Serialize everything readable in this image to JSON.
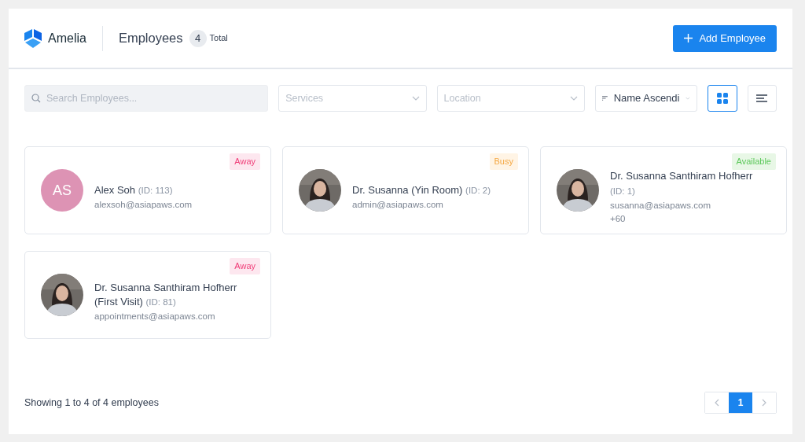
{
  "header": {
    "logo_text": "Amelia",
    "title": "Employees",
    "count": "4",
    "count_label": "Total",
    "add_button": "Add Employee"
  },
  "filters": {
    "search": {
      "placeholder": "Search Employees..."
    },
    "services": {
      "placeholder": "Services"
    },
    "location": {
      "placeholder": "Location"
    },
    "sort": {
      "value": "Name Ascendi"
    },
    "views": [
      {
        "kind": "grid",
        "selected": true
      },
      {
        "kind": "list",
        "selected": false
      }
    ]
  },
  "employees": [
    {
      "name": "Alex Soh",
      "id_label": "(ID: 113)",
      "email": "alexsoh@asiapaws.com",
      "status": {
        "kind": "away",
        "label": "Away"
      },
      "avatar": {
        "kind": "initials",
        "initials": "AS",
        "color": "#dd93b4"
      }
    },
    {
      "name": "Dr. Susanna (Yin Room)",
      "id_label": "(ID: 2)",
      "email": "admin@asiapaws.com",
      "status": {
        "kind": "busy",
        "label": "Busy"
      }
    },
    {
      "name": "Dr. Susanna Santhiram Hofherr",
      "id_label": "(ID: 1)",
      "email": "susanna@asiapaws.com",
      "phone": "+60",
      "status": {
        "kind": "available",
        "label": "Available"
      }
    },
    {
      "name": "Dr. Susanna Santhiram Hofherr (First Visit)",
      "id_label": "(ID: 81)",
      "email": "appointments@asiapaws.com",
      "status": {
        "kind": "away",
        "label": "Away"
      }
    }
  ],
  "footer": {
    "summary": "Showing 1 to 4 of 4 employees",
    "pages": [
      {
        "label": "1",
        "selected": true
      }
    ]
  }
}
